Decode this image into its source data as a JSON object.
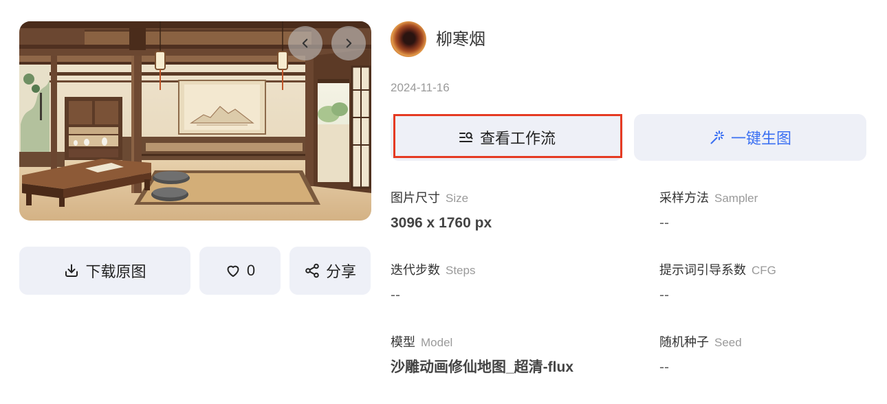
{
  "author": {
    "name": "柳寒烟"
  },
  "date": "2024-11-16",
  "gallery": {
    "prev_icon": "chevron-left-icon",
    "next_icon": "chevron-right-icon"
  },
  "actions": {
    "download_label": "下载原图",
    "download_icon": "download-icon",
    "like_count": "0",
    "like_icon": "heart-icon",
    "share_label": "分享",
    "share_icon": "share-icon"
  },
  "buttons": {
    "view_workflow": {
      "label": "查看工作流",
      "icon": "workflow-icon"
    },
    "generate": {
      "label": "一键生图",
      "icon": "magic-wand-icon"
    }
  },
  "params": [
    {
      "label": "图片尺寸",
      "label_en": "Size",
      "value": "3096 x 1760 px"
    },
    {
      "label": "采样方法",
      "label_en": "Sampler",
      "value": "--"
    },
    {
      "label": "迭代步数",
      "label_en": "Steps",
      "value": "--"
    },
    {
      "label": "提示词引导系数",
      "label_en": "CFG",
      "value": "--"
    },
    {
      "label": "模型",
      "label_en": "Model",
      "value": "沙雕动画修仙地图_超清-flux"
    },
    {
      "label": "随机种子",
      "label_en": "Seed",
      "value": "--"
    }
  ],
  "colors": {
    "accent": "#3a6ff2",
    "button_bg": "#eef0f7",
    "highlight": "#e53a22",
    "muted_text": "#9a9a9a"
  }
}
